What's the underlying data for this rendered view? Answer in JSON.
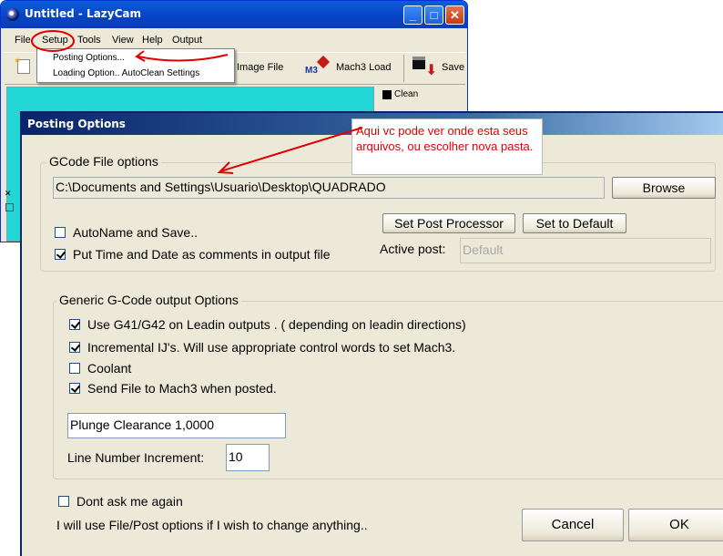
{
  "lazycam": {
    "title": "Untitled - LazyCam",
    "menu": [
      "File",
      "Setup",
      "Tools",
      "View",
      "Help",
      "Output"
    ],
    "toolbar": {
      "image_file": "Image File",
      "mach3_load": "Mach3 Load",
      "mach3_badge": "M3",
      "save": "Save"
    },
    "side_panel": {
      "clean": "Clean"
    },
    "setup_menu": {
      "items": [
        "Posting Options...",
        "Loading Option.. AutoClean Settings"
      ]
    }
  },
  "dialog": {
    "title": "Posting Options",
    "gcode_group": {
      "label": "GCode File options",
      "path": "C:\\Documents and Settings\\Usuario\\Desktop\\QUADRADO",
      "browse": "Browse",
      "autoname": {
        "label": "AutoName and Save..",
        "checked": false
      },
      "time_date": {
        "label": "Put Time and Date as comments in output file",
        "checked": true
      },
      "set_post_processor": "Set Post Processor",
      "set_to_default": "Set to Default",
      "active_post_label": "Active post:",
      "active_post_value": "Default"
    },
    "generic_group": {
      "label": "Generic G-Code output Options",
      "options": [
        {
          "label": "Use G41/G42 on Leadin outputs . ( depending on leadin directions)",
          "checked": true
        },
        {
          "label": "Incremental IJ's. Will use appropriate control words to set Mach3.",
          "checked": true
        },
        {
          "label": "Coolant",
          "checked": false
        },
        {
          "label": "Send File to Mach3 when posted.",
          "checked": true
        }
      ],
      "plunge_clearance": "Plunge Clearance 1,0000",
      "line_number_label": "Line Number Increment:",
      "line_number_value": "10"
    },
    "dont_ask": {
      "label": "Dont ask me again",
      "checked": false
    },
    "info_text": "I will use File/Post options if I wish to change anything..",
    "cancel": "Cancel",
    "ok": "OK"
  },
  "annotation": {
    "text": "Aqui vc pode ver onde esta seus arquivos, ou escolher nova pasta.",
    "color": "#e00000"
  },
  "colors": {
    "xp_title_blue": "#0a5ed8",
    "dialog_title_dark": "#0a246a",
    "canvas_cyan": "#22d6d6",
    "window_face": "#ece9d8",
    "annotation_red": "#e00000"
  }
}
